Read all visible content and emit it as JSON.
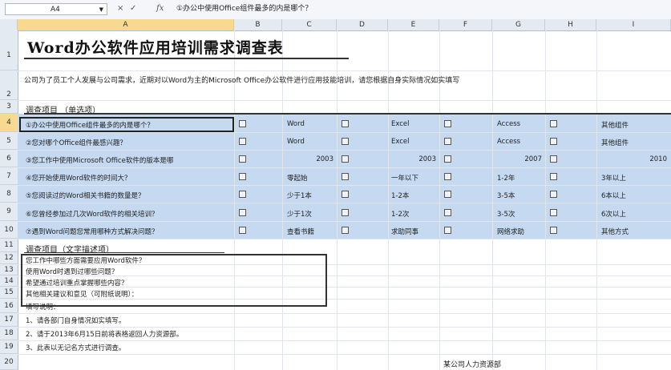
{
  "formula_bar": {
    "name_box": "A4",
    "fx_label": "fx",
    "formula": "①办公中使用Office组件最多的内是哪个？"
  },
  "columns": [
    "A",
    "B",
    "C",
    "D",
    "E",
    "F",
    "G",
    "H",
    "I"
  ],
  "rows": [
    "1",
    "2",
    "3",
    "4",
    "5",
    "6",
    "7",
    "8",
    "9",
    "10",
    "11",
    "12",
    "13",
    "14",
    "15",
    "16",
    "17",
    "18",
    "19",
    "20"
  ],
  "sheet": {
    "title": "Word办公软件应用培训需求调查表",
    "intro": "公司为了员工个人发展与公司需求，近期对以Word为主的Microsoft Office办公软件进行应用技能培训，请您根据自身实际情况如实填写",
    "section1": "调查项目 （单选项）",
    "questions": [
      {
        "q": "①办公中使用Office组件最多的内是哪个？",
        "opts": [
          "Word",
          "Excel",
          "Access",
          "其他组件"
        ]
      },
      {
        "q": "②您对哪个Office组件最感兴趣？",
        "opts": [
          "Word",
          "Excel",
          "Access",
          "其他组件"
        ]
      },
      {
        "q": "③您工作中使用Microsoft Office软件的版本是哪",
        "opts": [
          "2003",
          "2003",
          "2007",
          "2010"
        ]
      },
      {
        "q": "④您开始使用Word软件的时间大？",
        "opts": [
          "零起始",
          "一年以下",
          "1-2年",
          "3年以上"
        ]
      },
      {
        "q": "⑤您阅读过的Word相关书籍的数量是？",
        "opts": [
          "少于1本",
          "1-2本",
          "3-5本",
          "6本以上"
        ]
      },
      {
        "q": "⑥您曾经参加过几次Word软件的相关培训？",
        "opts": [
          "少于1次",
          "1-2次",
          "3-5次",
          "6次以上"
        ]
      },
      {
        "q": "⑦遇到Word问题您常用哪种方式解决问题？",
        "opts": [
          "查看书籍",
          "求助同事",
          "网络求助",
          "其他方式"
        ]
      }
    ],
    "section2": "调查项目（文字描述项）",
    "text_items": [
      "您工作中哪些方面需要应用Word软件？",
      "使用Word时遇到过哪些问题？",
      "希望通过培训重点掌握哪些内容？",
      "其他相关建议和意见（可附纸说明）："
    ],
    "notes_title": "填写说明：",
    "notes": [
      "1、请各部门自身情况如实填写。",
      "2、请于2013年6月15日前将表格返回人力资源部。",
      "3、此表以无记名方式进行调查。"
    ],
    "footer": "某公司人力资源部"
  }
}
